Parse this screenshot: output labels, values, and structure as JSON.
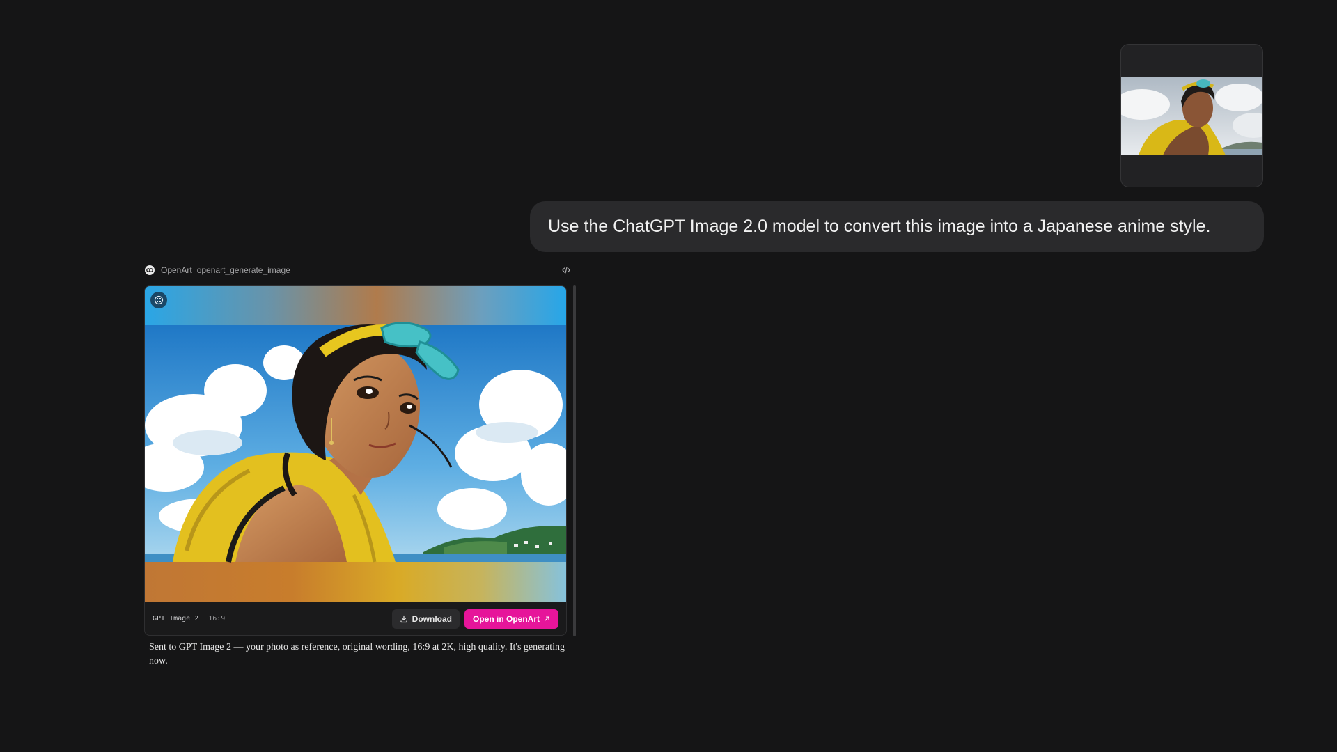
{
  "user": {
    "message": "Use the ChatGPT Image 2.0 model to convert this image into a Japanese anime style."
  },
  "tool": {
    "app_name": "OpenArt",
    "function_name": "openart_generate_image",
    "icons": {
      "logo": "openart-logo-icon",
      "code": "code-icon",
      "expand": "expand-icon"
    }
  },
  "result": {
    "model": "GPT Image 2",
    "aspect_ratio": "16:9",
    "download_label": "Download",
    "open_label": "Open in OpenArt",
    "accent_color": "#e6159a"
  },
  "assistant": {
    "message": "Sent to GPT Image 2 — your photo as reference, original wording, 16:9 at 2K, high quality. It's generating now."
  }
}
